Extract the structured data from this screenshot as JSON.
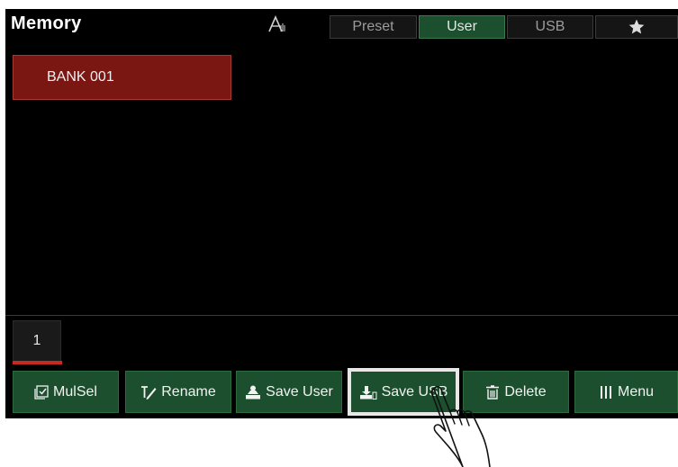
{
  "header": {
    "title": "Memory",
    "font_tool_icon": "font-settings-icon",
    "tabs": [
      {
        "label": "Preset",
        "active": false
      },
      {
        "label": "User",
        "active": true
      },
      {
        "label": "USB",
        "active": false
      }
    ],
    "favorites_icon": "star-icon"
  },
  "bank_list": {
    "items": [
      {
        "label": "BANK 001",
        "selected": true
      }
    ]
  },
  "pagination": {
    "pages": [
      "1"
    ],
    "current": "1"
  },
  "toolbar": {
    "mulsel_label": "MulSel",
    "rename_label": "Rename",
    "save_user_label": "Save User",
    "save_usb_label": "Save USB",
    "delete_label": "Delete",
    "menu_label": "Menu"
  },
  "colors": {
    "accent_green": "#1c4f2e",
    "selected_red": "#7a1712",
    "page_indicator": "#c62a1f"
  }
}
